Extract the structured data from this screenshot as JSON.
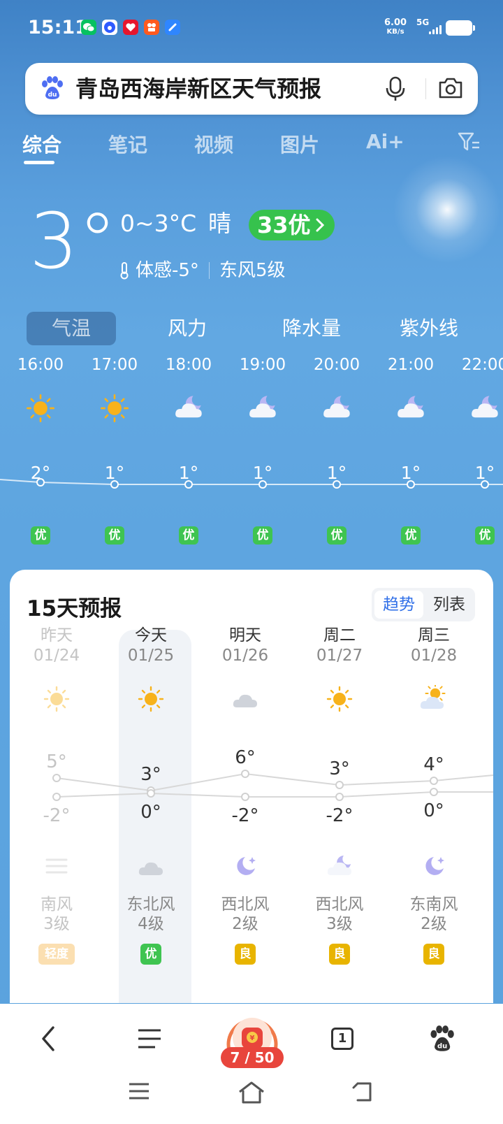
{
  "status_bar": {
    "time": "15:11",
    "net_speed_value": "6.00",
    "net_speed_unit": "KB/s",
    "network_type": "5G",
    "app_icons": [
      "wechat-icon",
      "baidu-app-icon",
      "red-heart-app-icon",
      "kuaishou-icon",
      "blue-app-icon"
    ]
  },
  "search": {
    "query": "青岛西海岸新区天气预报"
  },
  "tabs": [
    {
      "label": "综合",
      "active": true
    },
    {
      "label": "笔记"
    },
    {
      "label": "视频"
    },
    {
      "label": "图片"
    },
    {
      "label": "Ai+"
    }
  ],
  "current": {
    "temp": "3°",
    "range": "0~3°C",
    "condition": "晴",
    "aqi": "33优",
    "feels_like": "体感-5°",
    "wind": "东风5级"
  },
  "metric_tabs": [
    "气温",
    "风力",
    "降水量",
    "紫外线"
  ],
  "hourly": [
    {
      "time": "16:00",
      "icon": "sun",
      "temp": "2°",
      "aqi": "优"
    },
    {
      "time": "17:00",
      "icon": "sun",
      "temp": "1°",
      "aqi": "优"
    },
    {
      "time": "18:00",
      "icon": "moon-cloud",
      "temp": "1°",
      "aqi": "优"
    },
    {
      "time": "19:00",
      "icon": "moon-cloud",
      "temp": "1°",
      "aqi": "优"
    },
    {
      "time": "20:00",
      "icon": "moon-cloud",
      "temp": "1°",
      "aqi": "优"
    },
    {
      "time": "21:00",
      "icon": "moon-cloud",
      "temp": "1°",
      "aqi": "优"
    },
    {
      "time": "22:00",
      "icon": "moon-cloud",
      "temp": "1°",
      "aqi": "优"
    }
  ],
  "forecast": {
    "title": "15天预报",
    "toggle_on": "趋势",
    "toggle_off": "列表",
    "days": [
      {
        "day": "昨天",
        "date": "01/24",
        "day_icon": "sun",
        "high": "5°",
        "low": "-2°",
        "night_icon": "haze",
        "wind_dir": "南风",
        "wind_level": "3级",
        "aqi": "轻度",
        "aqi_color": "#f5a623"
      },
      {
        "day": "今天",
        "date": "01/25",
        "day_icon": "sun",
        "high": "3°",
        "low": "0°",
        "night_icon": "cloud",
        "wind_dir": "东北风",
        "wind_level": "4级",
        "aqi": "优",
        "aqi_color": "#3fc451"
      },
      {
        "day": "明天",
        "date": "01/26",
        "day_icon": "cloud",
        "high": "6°",
        "low": "-2°",
        "night_icon": "moon-star",
        "wind_dir": "西北风",
        "wind_level": "2级",
        "aqi": "良",
        "aqi_color": "#e8b400"
      },
      {
        "day": "周二",
        "date": "01/27",
        "day_icon": "sun",
        "high": "3°",
        "low": "-2°",
        "night_icon": "moon-cloud",
        "wind_dir": "西北风",
        "wind_level": "3级",
        "aqi": "良",
        "aqi_color": "#e8b400"
      },
      {
        "day": "周三",
        "date": "01/28",
        "day_icon": "sun-cloud",
        "high": "4°",
        "low": "0°",
        "night_icon": "moon-star",
        "wind_dir": "东南风",
        "wind_level": "2级",
        "aqi": "良",
        "aqi_color": "#e8b400"
      }
    ]
  },
  "bottom_nav": {
    "reward_count": "7 / 50",
    "tab_count": "1"
  }
}
